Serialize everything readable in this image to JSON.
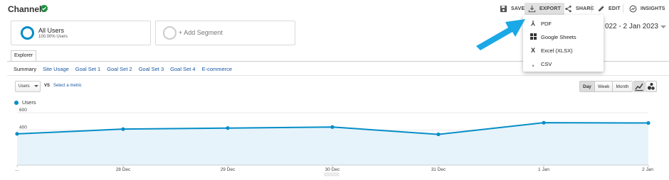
{
  "header": {
    "title": "Channels",
    "toolbar": {
      "save": "SAVE",
      "export": "EXPORT",
      "share": "SHARE",
      "edit": "EDIT",
      "insights": "INSIGHTS"
    }
  },
  "segments": [
    {
      "title": "All Users",
      "subtitle": "100.00% Users"
    },
    {
      "title": "+ Add Segment"
    }
  ],
  "date_range": "022 - 2 Jan 2023",
  "explorer_tab": "Explorer",
  "subtabs": [
    "Summary",
    "Site Usage",
    "Goal Set 1",
    "Goal Set 2",
    "Goal Set 3",
    "Goal Set 4",
    "E-commerce"
  ],
  "metric_select": {
    "primary": "Users",
    "vs": "VS",
    "secondary": "Select a metric"
  },
  "granularity": {
    "buttons": [
      "Day",
      "Week",
      "Month"
    ],
    "selected": "Day"
  },
  "legend": {
    "series": "Users"
  },
  "export_menu": {
    "items": [
      {
        "label": "PDF",
        "icon": "pdf-icon"
      },
      {
        "label": "Google Sheets",
        "icon": "sheets-icon"
      },
      {
        "label": "Excel (XLSX)",
        "icon": "excel-icon"
      },
      {
        "label": "CSV",
        "icon": "csv-icon"
      }
    ]
  },
  "colors": {
    "series": "#058dc7",
    "area": "#e6f3fa",
    "arrow": "#1aa8e6"
  },
  "chart_data": {
    "type": "area",
    "series_name": "Users",
    "x": [
      "...",
      "28 Dec",
      "29 Dec",
      "30 Dec",
      "31 Dec",
      "1 Jan",
      "2 Jan"
    ],
    "values": [
      358,
      412,
      424,
      436,
      352,
      485,
      482
    ],
    "yticks": [
      "600",
      "400",
      "200"
    ],
    "ylim": [
      0,
      600
    ]
  }
}
